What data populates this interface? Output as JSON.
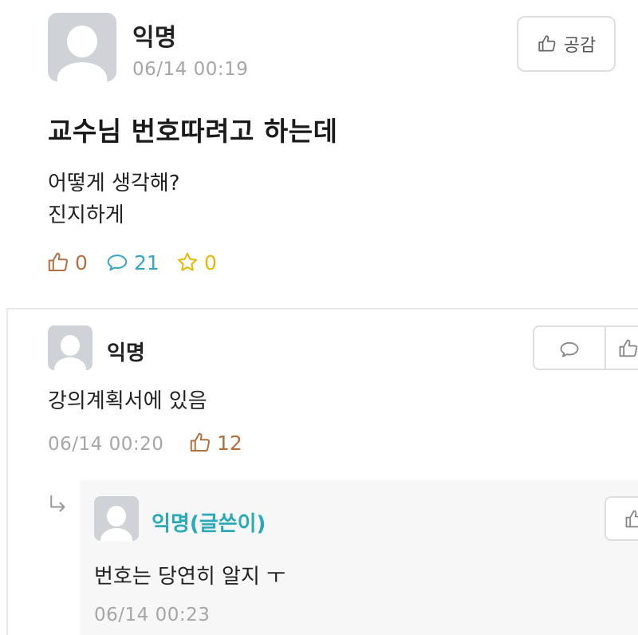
{
  "post": {
    "author": "익명",
    "timestamp": "06/14 00:19",
    "like_button_label": "공감",
    "title": "교수님 번호따려고 하는데",
    "body_lines": [
      "어떻게 생각해?",
      "진지하게"
    ],
    "stats": {
      "likes": "0",
      "comments": "21",
      "scraps": "0"
    }
  },
  "comments": [
    {
      "author": "익명",
      "text": "강의계획서에 있음",
      "timestamp": "06/14 00:20",
      "likes": "12",
      "replies": [
        {
          "author": "익명(글쓴이)",
          "text": "번호는 당연히 알지 ㅜ",
          "timestamp": "06/14 00:23"
        }
      ]
    }
  ],
  "colors": {
    "like": "#b3703f",
    "comment": "#35a6c6",
    "scrap": "#e6b800",
    "op_author": "#2aa9b8",
    "meta_gray": "#a6a6a6",
    "avatar_bg": "#cfd3d8"
  },
  "icons": {
    "like": "thumbs-up-icon",
    "comment": "speech-bubble-icon",
    "scrap": "star-icon",
    "reply": "reply-arrow-icon"
  }
}
